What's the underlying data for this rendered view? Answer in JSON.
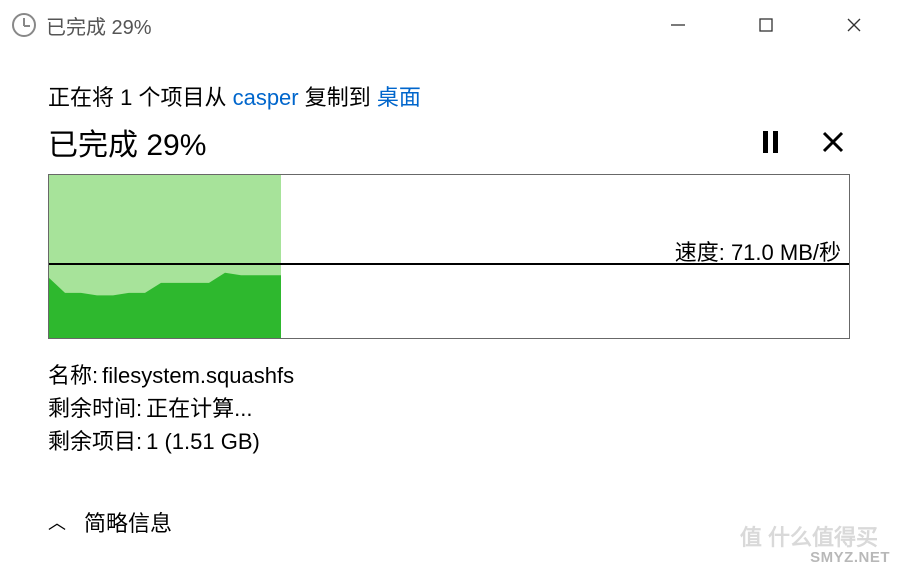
{
  "window": {
    "title": "已完成 29%"
  },
  "copy": {
    "prefix": "正在将 1 个项目从 ",
    "source": "casper",
    "mid": " 复制到 ",
    "dest": "桌面"
  },
  "progress": {
    "heading": "已完成 29%",
    "percent": 29
  },
  "speed": {
    "label": "速度: 71.0 MB/秒",
    "value_mb_s": 71.0
  },
  "details": {
    "name_label": "名称:",
    "name_value": "filesystem.squashfs",
    "time_label": "剩余时间:",
    "time_value": "正在计算...",
    "items_label": "剩余项目:",
    "items_value": "1 (1.51 GB)"
  },
  "footer": {
    "toggle_label": "简略信息"
  },
  "watermark": {
    "text1": "SMYZ.NET",
    "text2": "值 什么值得买"
  },
  "chart_data": {
    "type": "area",
    "title": "",
    "xlabel": "",
    "ylabel": "MB/秒",
    "progress_fraction": 0.29,
    "current_speed_line": 71.0,
    "ylim": [
      0,
      130
    ],
    "x": [
      0,
      2,
      4,
      6,
      8,
      10,
      12,
      14,
      16,
      18,
      20,
      22,
      24,
      26,
      28,
      29
    ],
    "values": [
      48,
      36,
      36,
      34,
      34,
      36,
      36,
      44,
      44,
      44,
      44,
      52,
      50,
      50,
      50,
      50
    ]
  }
}
